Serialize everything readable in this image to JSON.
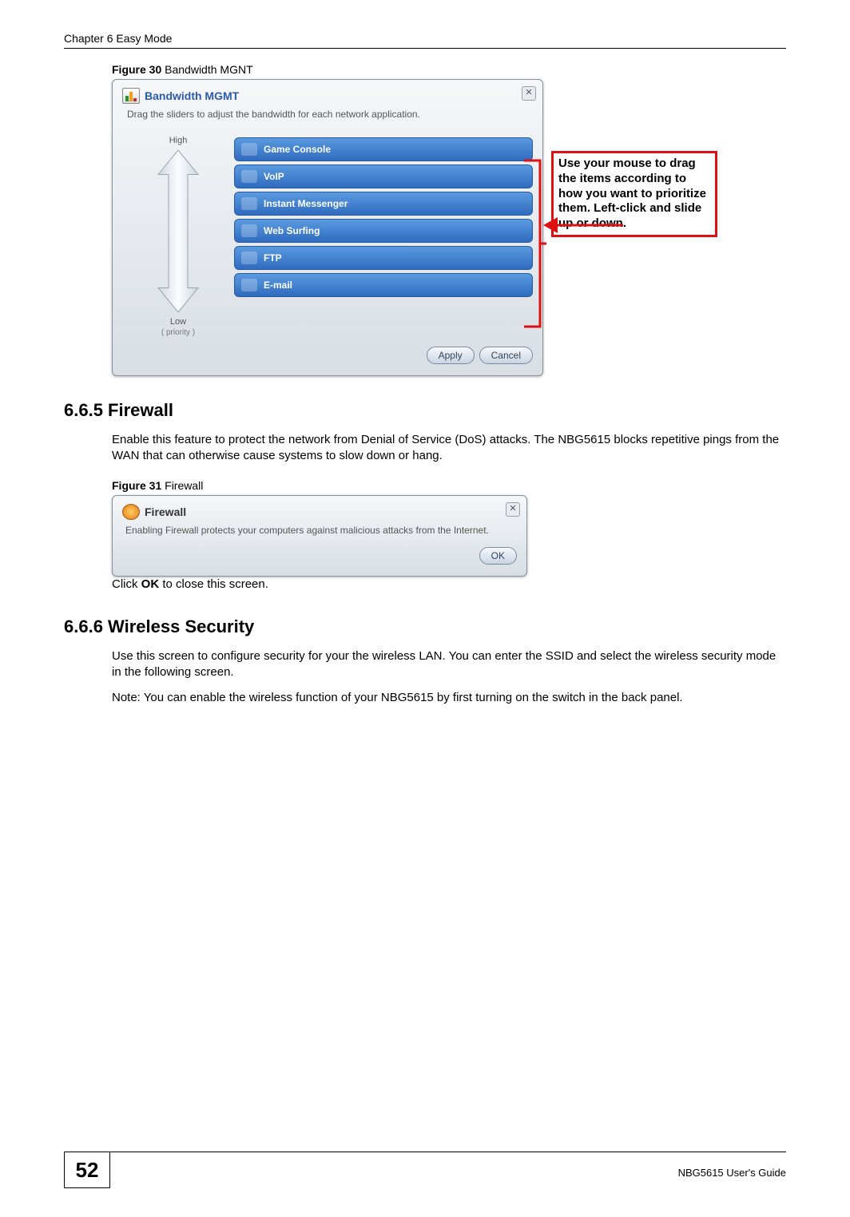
{
  "header": {
    "chapter": "Chapter 6 Easy Mode"
  },
  "fig30": {
    "caption_bold": "Figure 30",
    "caption_rest": "   Bandwidth MGNT",
    "dialog_title": "Bandwidth MGMT",
    "subtitle": "Drag the sliders to adjust the bandwidth for each network application.",
    "high": "High",
    "low": "Low",
    "priority": "( priority )",
    "items": [
      "Game Console",
      "VoIP",
      "Instant Messenger",
      "Web Surfing",
      "FTP",
      "E-mail"
    ],
    "apply": "Apply",
    "cancel": "Cancel",
    "callout": "Use your mouse to drag the items according to how you want to prioritize them. Left-click and slide up or down."
  },
  "sec665": {
    "heading": "6.6.5  Firewall",
    "para": "Enable this feature to protect the network from Denial of Service (DoS) attacks. The NBG5615 blocks repetitive pings from the WAN that can otherwise cause systems to slow down or hang."
  },
  "fig31": {
    "caption_bold": "Figure 31",
    "caption_rest": "   Firewall",
    "dialog_title": "Firewall",
    "body": "Enabling Firewall protects your computers against malicious attacks from the Internet.",
    "ok": "OK",
    "after_prefix": "Click ",
    "after_bold": "OK",
    "after_suffix": " to close this screen."
  },
  "sec666": {
    "heading": "6.6.6  Wireless Security",
    "para": "Use this screen to configure security for your the wireless LAN. You can enter the SSID and select the wireless security mode in the following screen.",
    "note": "Note: You can enable the wireless function of your NBG5615 by first turning on the switch in the back panel."
  },
  "footer": {
    "page": "52",
    "guide": "NBG5615 User's Guide"
  }
}
